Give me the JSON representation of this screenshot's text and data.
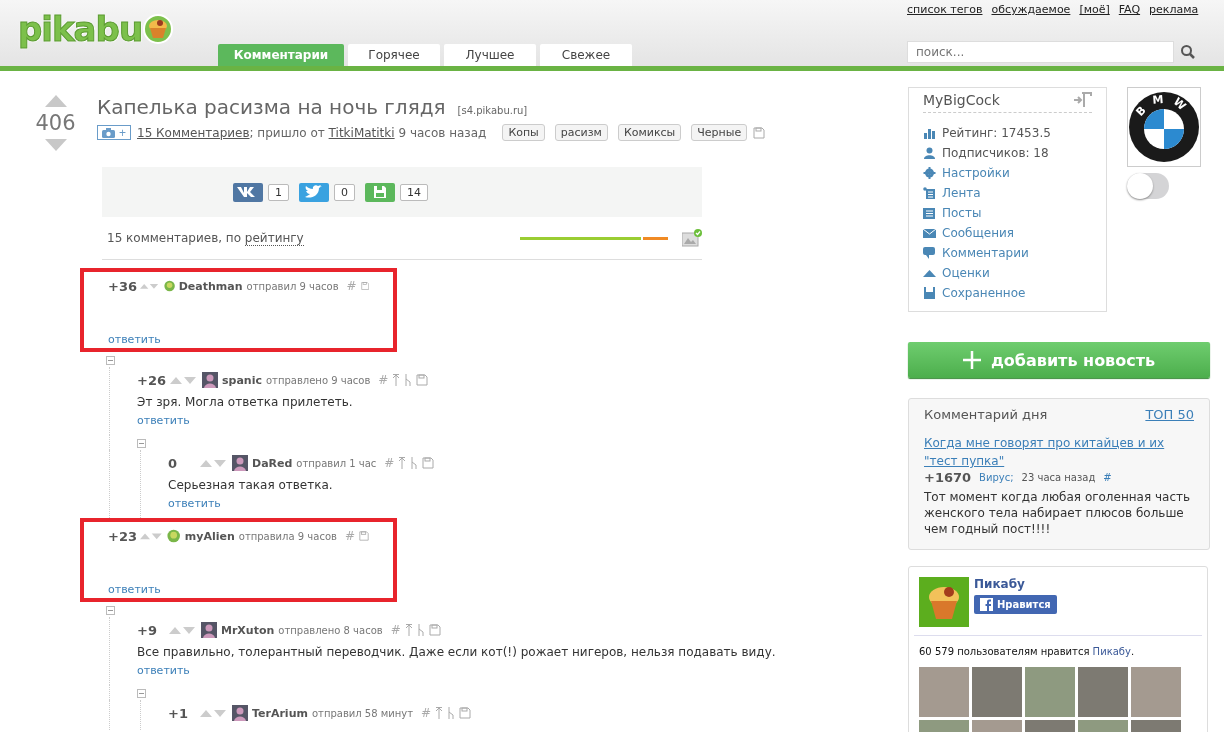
{
  "header": {
    "logo": "pikabu",
    "top_links": [
      "список тегов",
      "обсуждаемое",
      "[моё]",
      "FAQ",
      "реклама"
    ],
    "tabs": [
      {
        "label": "Комментарии",
        "selected": true
      },
      {
        "label": "Горячее",
        "selected": false
      },
      {
        "label": "Лучшее",
        "selected": false
      },
      {
        "label": "Свежее",
        "selected": false
      }
    ],
    "search": {
      "placeholder": "поиск..."
    }
  },
  "post": {
    "rating": "406",
    "title": "Капелька расизма на ночь глядя",
    "source": "[s4.pikabu.ru]",
    "add_button": "+",
    "meta": {
      "comments_link": "15 Комментариев",
      "from": "; пришло от ",
      "author": "TitkiMatitki",
      "time": " 9 часов назад"
    },
    "tags": [
      "Копы",
      "расизм",
      "Комиксы",
      "Черные"
    ],
    "share": [
      {
        "kind": "vk",
        "count": "1"
      },
      {
        "kind": "twitter",
        "count": "0"
      },
      {
        "kind": "save",
        "count": "14"
      }
    ],
    "sort": {
      "text": "15 комментариев, по ",
      "link": "рейтингу"
    },
    "rating_bar": {
      "level": 0.83
    }
  },
  "comments": [
    {
      "score": "+36",
      "author": "Deathman",
      "action": "отправил 9 часов",
      "hash": "#",
      "highlighted": true,
      "reply": "ответить",
      "children": [
        {
          "score": "+26",
          "author": "spanic",
          "action": "отправлено 9 часов",
          "hash": "#",
          "text": "Эт зря. Могла ответка прилететь.",
          "reply": "ответить",
          "children": [
            {
              "score": "0",
              "author": "DaRed",
              "action": "отправил 1 час",
              "hash": "#",
              "text": "Серьезная такая ответка.",
              "reply": "ответить"
            }
          ]
        }
      ]
    },
    {
      "score": "+23",
      "author": "myAlien",
      "action": "отправила 9 часов",
      "hash": "#",
      "highlighted": true,
      "reply": "ответить",
      "children": [
        {
          "score": "+9",
          "author": "MrXuton",
          "action": "отправлено 8 часов",
          "hash": "#",
          "text": "Все правильно, толерантный переводчик. Даже если кот(!) рожает нигеров, нельзя подавать виду.",
          "reply": "ответить",
          "children": [
            {
              "score": "+1",
              "author": "TerArium",
              "action": "отправил 58 минут",
              "hash": "#"
            }
          ]
        }
      ]
    }
  ],
  "sidebar": {
    "user": {
      "name": "MyBigCock",
      "avatar_text": "BMW",
      "toggle_on": false,
      "menu": [
        {
          "kind": "rating",
          "label": "Рейтинг: 17453.5",
          "link": false
        },
        {
          "kind": "subscribers",
          "label": "Подписчиков: 18",
          "link": false
        },
        {
          "kind": "settings",
          "label": "Настройки",
          "link": true
        },
        {
          "kind": "feed",
          "label": "Лента",
          "link": true
        },
        {
          "kind": "posts",
          "label": "Посты",
          "link": true
        },
        {
          "kind": "messages",
          "label": "Сообщения",
          "link": true
        },
        {
          "kind": "comments",
          "label": "Комментарии",
          "link": true
        },
        {
          "kind": "votes",
          "label": "Оценки",
          "link": true
        },
        {
          "kind": "saved",
          "label": "Сохраненное",
          "link": true
        }
      ]
    },
    "add_news": "добавить новость",
    "comment_of_day": {
      "title": "Комментарий дня",
      "top_link": "ТОП 50",
      "post_link": "Когда мне говорят про китайцев и их \"тест пупка\"",
      "score": "+1670",
      "author": "Вирус;",
      "time": "23 часа назад",
      "hash": "#",
      "text": "Тот момент когда любая оголенная часть женского тела набирает плюсов больше чем годный пост!!!!"
    },
    "facebook": {
      "page": "Пикабу",
      "like": "Нравится",
      "fans_before": "60 579 пользователям нравится ",
      "fans_link": "Пикабу",
      "fans_after": "."
    }
  }
}
